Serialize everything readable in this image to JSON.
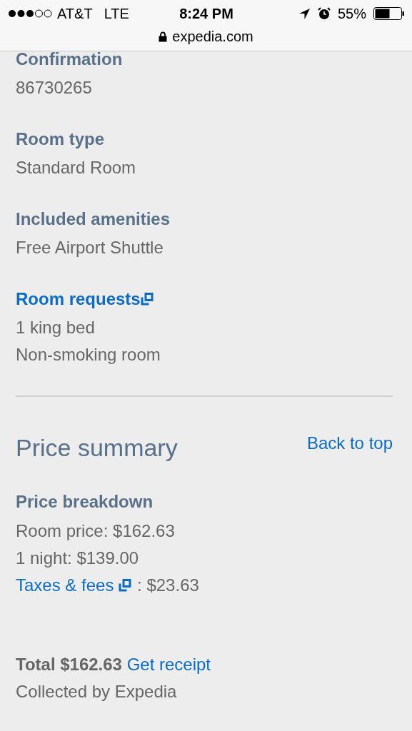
{
  "status_bar": {
    "carrier": "AT&T",
    "network": "LTE",
    "time": "8:24 PM",
    "battery": "55%"
  },
  "address_bar": {
    "url": "expedia.com"
  },
  "details": [
    {
      "label": "Confirmation",
      "kind": "plain",
      "lines": [
        "86730265"
      ]
    },
    {
      "label": "Room type",
      "kind": "plain",
      "lines": [
        "Standard Room"
      ]
    },
    {
      "label": "Included amenities",
      "kind": "plain",
      "lines": [
        "Free Airport Shuttle"
      ]
    },
    {
      "label": "Room requests",
      "kind": "link",
      "lines": [
        "1 king bed",
        "Non-smoking room"
      ]
    }
  ],
  "price_summary": {
    "title": "Price summary",
    "back_link": "Back to top",
    "breakdown_title": "Price breakdown",
    "lines": [
      {
        "kind": "text",
        "text": "Room price: $162.63"
      },
      {
        "kind": "text",
        "text": "1 night: $139.00"
      },
      {
        "kind": "link",
        "link": "Taxes & fees",
        "text": ": $23.63"
      }
    ],
    "total": "Total $162.63",
    "receipt_link": "Get receipt",
    "collected": "Collected by Expedia"
  }
}
